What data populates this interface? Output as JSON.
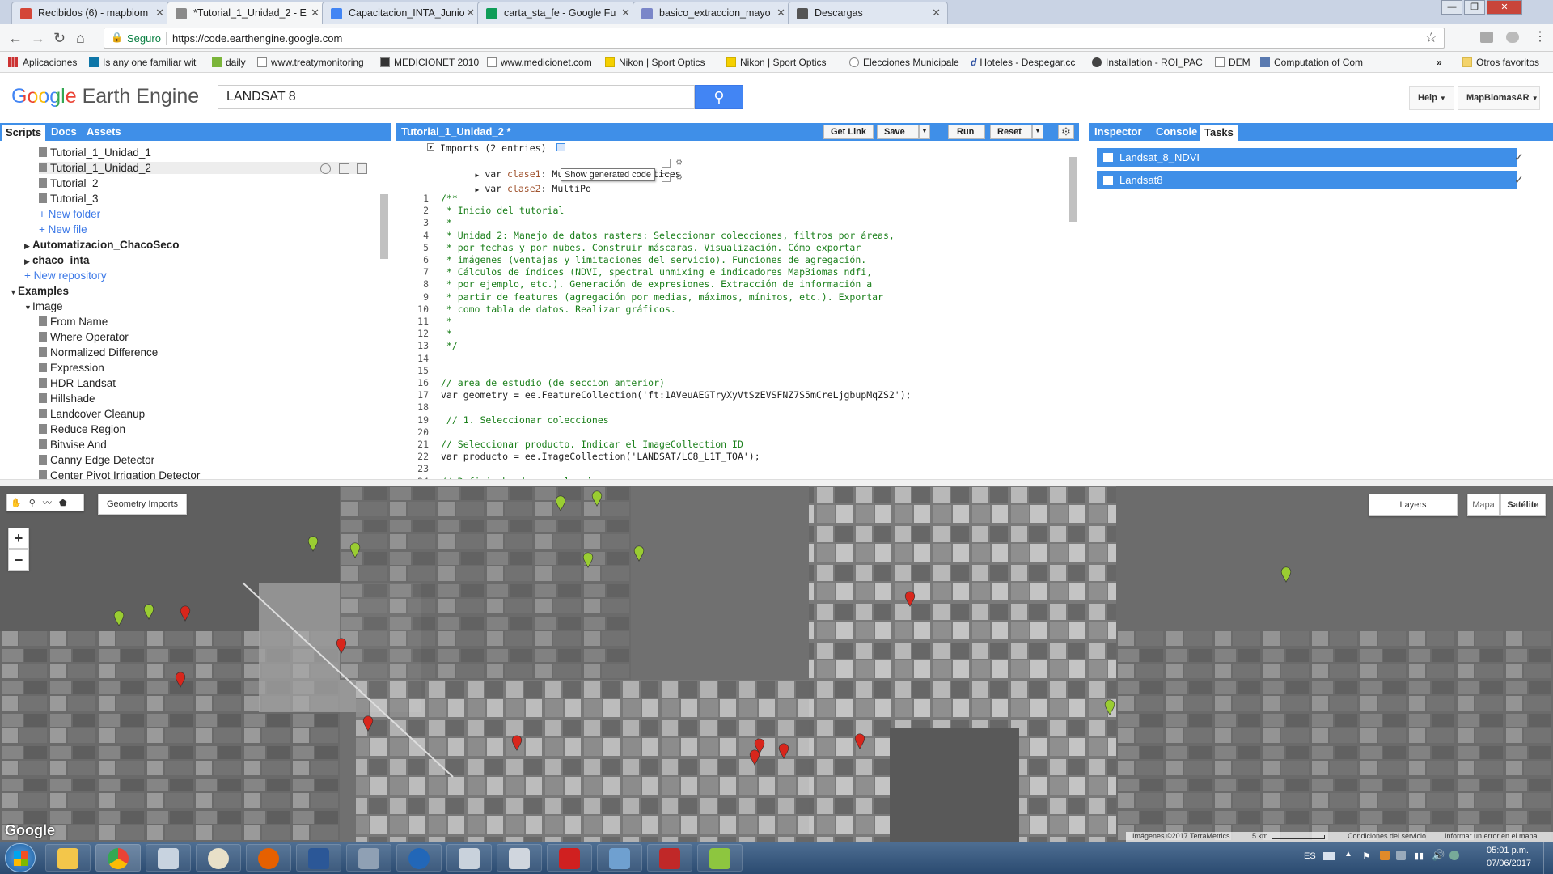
{
  "browser": {
    "tabs": [
      {
        "label": "Recibidos (6) - mapbiom",
        "color": "#d44638"
      },
      {
        "label": "*Tutorial_1_Unidad_2 - E",
        "color": "#8a8a8a"
      },
      {
        "label": "Capacitacion_INTA_Junio",
        "color": "#4285f4"
      },
      {
        "label": "carta_sta_fe - Google Fu",
        "color": "#0f9d58"
      },
      {
        "label": "basico_extraccion_mayo",
        "color": "#7a86c9"
      },
      {
        "label": "Descargas",
        "color": "#555555"
      }
    ],
    "secure_label": "Seguro",
    "url": "https://code.earthengine.google.com",
    "bookmarks": [
      "Aplicaciones",
      "Is any one familiar wit",
      "daily",
      "www.treatymonitoring",
      "MEDICIONET 2010",
      "www.medicionet.com",
      "Nikon | Sport Optics",
      "Nikon | Sport Optics",
      "Elecciones Municipale",
      "Hoteles - Despegar.cc",
      "Installation - ROI_PAC",
      "DEM",
      "Computation of Com"
    ],
    "bookmarks_more": "»",
    "other_bookmarks": "Otros favoritos"
  },
  "header": {
    "logo_google": "Google",
    "logo_product": "Earth Engine",
    "search_value": "LANDSAT 8",
    "help_label": "Help",
    "user_label": "MapBiomasAR"
  },
  "left_panel": {
    "tabs": [
      "Scripts",
      "Docs",
      "Assets"
    ],
    "items": [
      {
        "label": "Tutorial_1_Unidad_1",
        "kind": "file",
        "indent": 1
      },
      {
        "label": "Tutorial_1_Unidad_2",
        "kind": "file",
        "indent": 1
      },
      {
        "label": "Tutorial_2",
        "kind": "file",
        "indent": 1
      },
      {
        "label": "Tutorial_3",
        "kind": "file",
        "indent": 1
      },
      {
        "label": "+ New folder",
        "kind": "new",
        "indent": 1
      },
      {
        "label": "+ New file",
        "kind": "new",
        "indent": 1
      },
      {
        "label": "Automatizacion_ChacoSeco",
        "kind": "repo",
        "indent": 0
      },
      {
        "label": "chaco_inta",
        "kind": "repo",
        "indent": 0
      },
      {
        "label": "+ New repository",
        "kind": "new",
        "indent": 0
      },
      {
        "label": "Examples",
        "kind": "section",
        "indent": -1
      },
      {
        "label": "Image",
        "kind": "folder",
        "indent": 0
      },
      {
        "label": "From Name",
        "kind": "file",
        "indent": 1
      },
      {
        "label": "Where Operator",
        "kind": "file",
        "indent": 1
      },
      {
        "label": "Normalized Difference",
        "kind": "file",
        "indent": 1
      },
      {
        "label": "Expression",
        "kind": "file",
        "indent": 1
      },
      {
        "label": "HDR Landsat",
        "kind": "file",
        "indent": 1
      },
      {
        "label": "Hillshade",
        "kind": "file",
        "indent": 1
      },
      {
        "label": "Landcover Cleanup",
        "kind": "file",
        "indent": 1
      },
      {
        "label": "Reduce Region",
        "kind": "file",
        "indent": 1
      },
      {
        "label": "Bitwise And",
        "kind": "file",
        "indent": 1
      },
      {
        "label": "Canny Edge Detector",
        "kind": "file",
        "indent": 1
      },
      {
        "label": "Center Pivot Irrigation Detector",
        "kind": "file",
        "indent": 1
      }
    ]
  },
  "editor": {
    "title": "Tutorial_1_Unidad_2 *",
    "get_link": "Get Link",
    "save": "Save",
    "run": "Run",
    "reset": "Reset",
    "imports_header": "Imports (2 entries)",
    "imports": [
      {
        "prefix": "var ",
        "name": "clase1",
        "rest": ": MultiPoint, 10 vertices"
      },
      {
        "prefix": "var ",
        "name": "clase2",
        "rest": ": MultiPo"
      }
    ],
    "tooltip": "Show generated code",
    "lines": [
      {
        "n": "1",
        "t": "/**",
        "c": "cmt"
      },
      {
        "n": "2",
        "t": " * Inicio del tutorial",
        "c": "cmt"
      },
      {
        "n": "3",
        "t": " *",
        "c": "cmt"
      },
      {
        "n": "4",
        "t": " * Unidad 2: Manejo de datos rasters: Seleccionar colecciones, filtros por áreas,",
        "c": "cmt"
      },
      {
        "n": "5",
        "t": " * por fechas y por nubes. Construir máscaras. Visualización. Cómo exportar",
        "c": "cmt"
      },
      {
        "n": "6",
        "t": " * imágenes (ventajas y limitaciones del servicio). Funciones de agregación.",
        "c": "cmt"
      },
      {
        "n": "7",
        "t": " * Cálculos de índices (NDVI, spectral unmixing e indicadores MapBiomas ndfi,",
        "c": "cmt"
      },
      {
        "n": "8",
        "t": " * por ejemplo, etc.). Generación de expresiones. Extracción de información a",
        "c": "cmt"
      },
      {
        "n": "9",
        "t": " * partir de features (agregación por medias, máximos, mínimos, etc.). Exportar",
        "c": "cmt"
      },
      {
        "n": "10",
        "t": " * como tabla de datos. Realizar gráficos.",
        "c": "cmt"
      },
      {
        "n": "11",
        "t": " *",
        "c": "cmt"
      },
      {
        "n": "12",
        "t": " *",
        "c": "cmt"
      },
      {
        "n": "13",
        "t": " */",
        "c": "cmt"
      },
      {
        "n": "14",
        "t": "",
        "c": "cmt"
      },
      {
        "n": "15",
        "t": "",
        "c": "cmt"
      },
      {
        "n": "16",
        "t": "// area de estudio (de seccion anterior)",
        "c": "cmt"
      },
      {
        "n": "17",
        "t": "var geometry = ee.FeatureCollection('ft:1AVeuAEGTryXyVtSzEVSFNZ7S5mCreLjgbupMqZS2');",
        "c": "code"
      },
      {
        "n": "18",
        "t": "",
        "c": "cmt"
      },
      {
        "n": "19",
        "t": " // 1. Seleccionar colecciones",
        "c": "cmt"
      },
      {
        "n": "20",
        "t": "",
        "c": "cmt"
      },
      {
        "n": "21",
        "t": "// Seleccionar producto. Indicar el ImageCollection ID",
        "c": "cmt"
      },
      {
        "n": "22",
        "t": "var producto = ee.ImageCollection('LANDSAT/LC8_L1T_TOA');",
        "c": "code"
      },
      {
        "n": "23",
        "t": "",
        "c": "cmt"
      },
      {
        "n": "24",
        "t": "// Definir bandas a seleccionar",
        "c": "cmt"
      }
    ]
  },
  "right_panel": {
    "tabs": [
      "Inspector",
      "Console",
      "Tasks"
    ],
    "tasks": [
      "Landsat_8_NDVI",
      "Landsat8"
    ]
  },
  "map": {
    "geometry_imports": "Geometry Imports",
    "zoom_in": "+",
    "zoom_out": "−",
    "layers": "Layers",
    "map_type_map": "Mapa",
    "map_type_satellite": "Satélite",
    "google_watermark": "Google",
    "attribution": "Imágenes ©2017 TerraMetrics",
    "scale": "5 km",
    "terms": "Condiciones del servicio",
    "report": "Informar un error en el mapa",
    "marker_green": "#9acd32",
    "marker_red": "#d8261c"
  },
  "taskbar": {
    "lang": "ES",
    "time": "05:01 p.m.",
    "date": "07/06/2017"
  }
}
